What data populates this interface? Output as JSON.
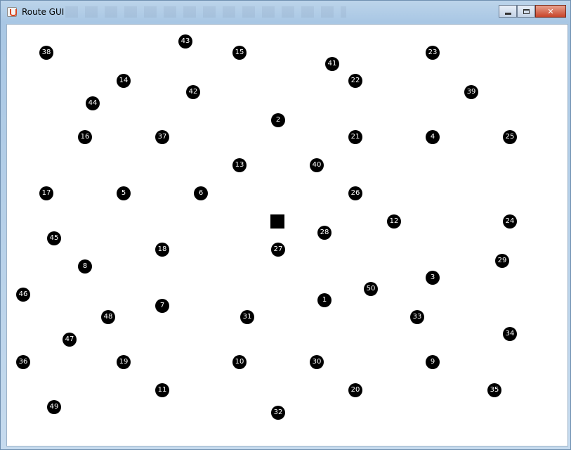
{
  "window": {
    "title": "Route GUI",
    "icon": "java-cup-icon",
    "caption_buttons": [
      "minimize",
      "maximize",
      "close"
    ]
  },
  "canvas": {
    "depot_marker": "filled-square",
    "nodes": [
      "38",
      "43",
      "15",
      "23",
      "41",
      "14",
      "42",
      "22",
      "39",
      "44",
      "2",
      "16",
      "37",
      "21",
      "4",
      "25",
      "13",
      "40",
      "17",
      "5",
      "6",
      "26",
      "12",
      "24",
      "45",
      "28",
      "18",
      "27",
      "29",
      "8",
      "3",
      "50",
      "46",
      "1",
      "7",
      "48",
      "31",
      "33",
      "34",
      "47",
      "36",
      "19",
      "10",
      "30",
      "9",
      "11",
      "20",
      "35",
      "49",
      "32"
    ]
  }
}
